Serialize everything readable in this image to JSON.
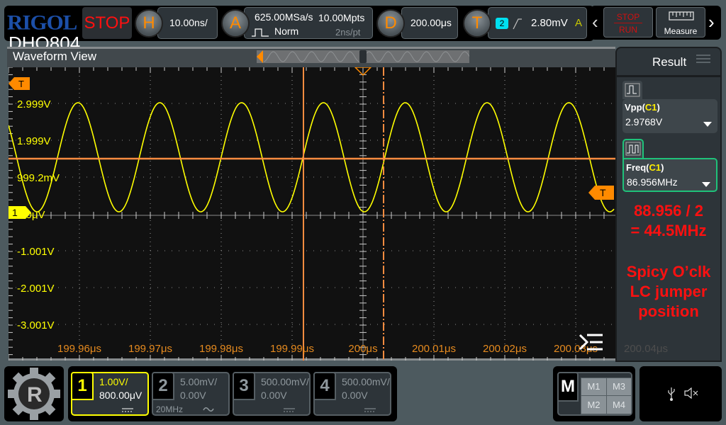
{
  "brand": {
    "logo": "RIGOL",
    "model": "DHO804"
  },
  "toolbar": {
    "run_state": "STOP",
    "horizontal": {
      "knob": "H",
      "timebase": "10.00ns/"
    },
    "acquire": {
      "knob": "A",
      "sample_rate": "625.00MSa/s",
      "memory_depth": "10.00Mpts",
      "mode": "Norm",
      "resolution": "2ns/pt"
    },
    "delay": {
      "knob": "D",
      "value": "200.00μs"
    },
    "trigger": {
      "knob": "T",
      "source": "2",
      "slope": "rising",
      "level": "2.80mV",
      "sweep": "A"
    },
    "stop_run_top": "STOP",
    "stop_run_bottom": "RUN",
    "measure_label": "Measure",
    "prev_icon": "‹",
    "next_icon": "›"
  },
  "waveform_view": {
    "title": "Waveform View",
    "trigger_marker": "T",
    "channel_marker": "1",
    "y_labels": [
      "2.999V",
      "1.999V",
      "999.2mV",
      "0.0μV",
      "-1.001V",
      "-2.001V",
      "-3.001V"
    ],
    "x_labels": [
      "199.96μs",
      "199.97μs",
      "199.98μs",
      "199.99μs",
      "200μs",
      "200.01μs",
      "200.02μs",
      "200.03μs",
      "200.04μs"
    ],
    "colors": {
      "ch1": "#ffff00",
      "cursor": "#ff8c40",
      "trigger": "#ff8a00",
      "axis_label": "#e58a1f"
    }
  },
  "result_panel": {
    "title": "Result",
    "measurements": [
      {
        "name": "Vpp",
        "source": "C1",
        "value": "2.9768V"
      },
      {
        "name": "Freq",
        "source": "C1",
        "value": "86.956MHz",
        "selected": true
      }
    ],
    "annotation_line1": "88.956 / 2",
    "annotation_line2": "= 44.5MHz",
    "annotation_line3": "Spicy O’clk",
    "annotation_line4": "LC jumper",
    "annotation_line5": "position"
  },
  "channels": [
    {
      "num": "1",
      "scale": "1.00V/",
      "offset": "800.00μV",
      "bw": "",
      "coupling": "DC",
      "active": true,
      "color": "#ffff00"
    },
    {
      "num": "2",
      "scale": "5.00mV/",
      "offset": "0.00V",
      "bw": "20MHz",
      "coupling": "AC",
      "active": false
    },
    {
      "num": "3",
      "scale": "500.00mV/",
      "offset": "0.00V",
      "bw": "",
      "coupling": "DC",
      "active": false
    },
    {
      "num": "4",
      "scale": "500.00mV/",
      "offset": "0.00V",
      "bw": "",
      "coupling": "DC",
      "active": false
    }
  ],
  "math": {
    "label": "M",
    "items": [
      "M1",
      "M3",
      "M2",
      "M4"
    ]
  },
  "status": {
    "usb": "usb-icon",
    "sound": "mute-icon"
  }
}
